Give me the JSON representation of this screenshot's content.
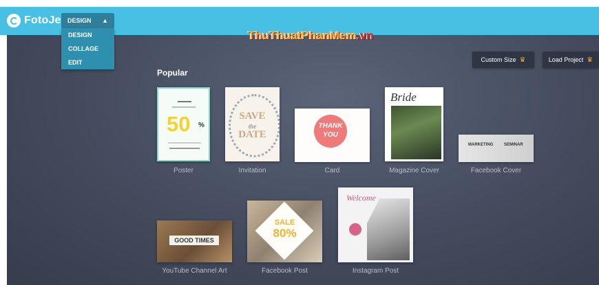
{
  "app": {
    "logo_text": "FotoJet"
  },
  "menu": {
    "selected": "DESIGN",
    "items": [
      "DESIGN",
      "COLLAGE",
      "EDIT"
    ]
  },
  "watermark": {
    "text_main": "ThuThuatPhanMem",
    "text_tld": ".vn"
  },
  "toolbar": {
    "custom_size": "Custom Size",
    "load_project": "Load Project"
  },
  "section_title": "Popular",
  "templates": {
    "poster": {
      "label": "Poster",
      "big": "50",
      "pct": "%"
    },
    "invitation": {
      "label": "Invitation",
      "l1": "SAVE",
      "l2": "the",
      "l3": "DATE"
    },
    "card": {
      "label": "Card",
      "l1": "THANK",
      "l2": "YOU"
    },
    "magazine": {
      "label": "Magazine Cover",
      "title": "Bride"
    },
    "facebook_cover": {
      "label": "Facebook Cover",
      "left": "MARKETING",
      "right": "SEMINAR"
    },
    "youtube": {
      "label": "YouTube Channel Art",
      "text": "GOOD TIMES"
    },
    "facebook_post": {
      "label": "Facebook Post",
      "l1": "SALE",
      "l2": "80%"
    },
    "instagram": {
      "label": "Instagram Post",
      "text": "Welcome"
    }
  },
  "colors": {
    "topbar": "#48c0e4",
    "accent": "#f2a334"
  }
}
